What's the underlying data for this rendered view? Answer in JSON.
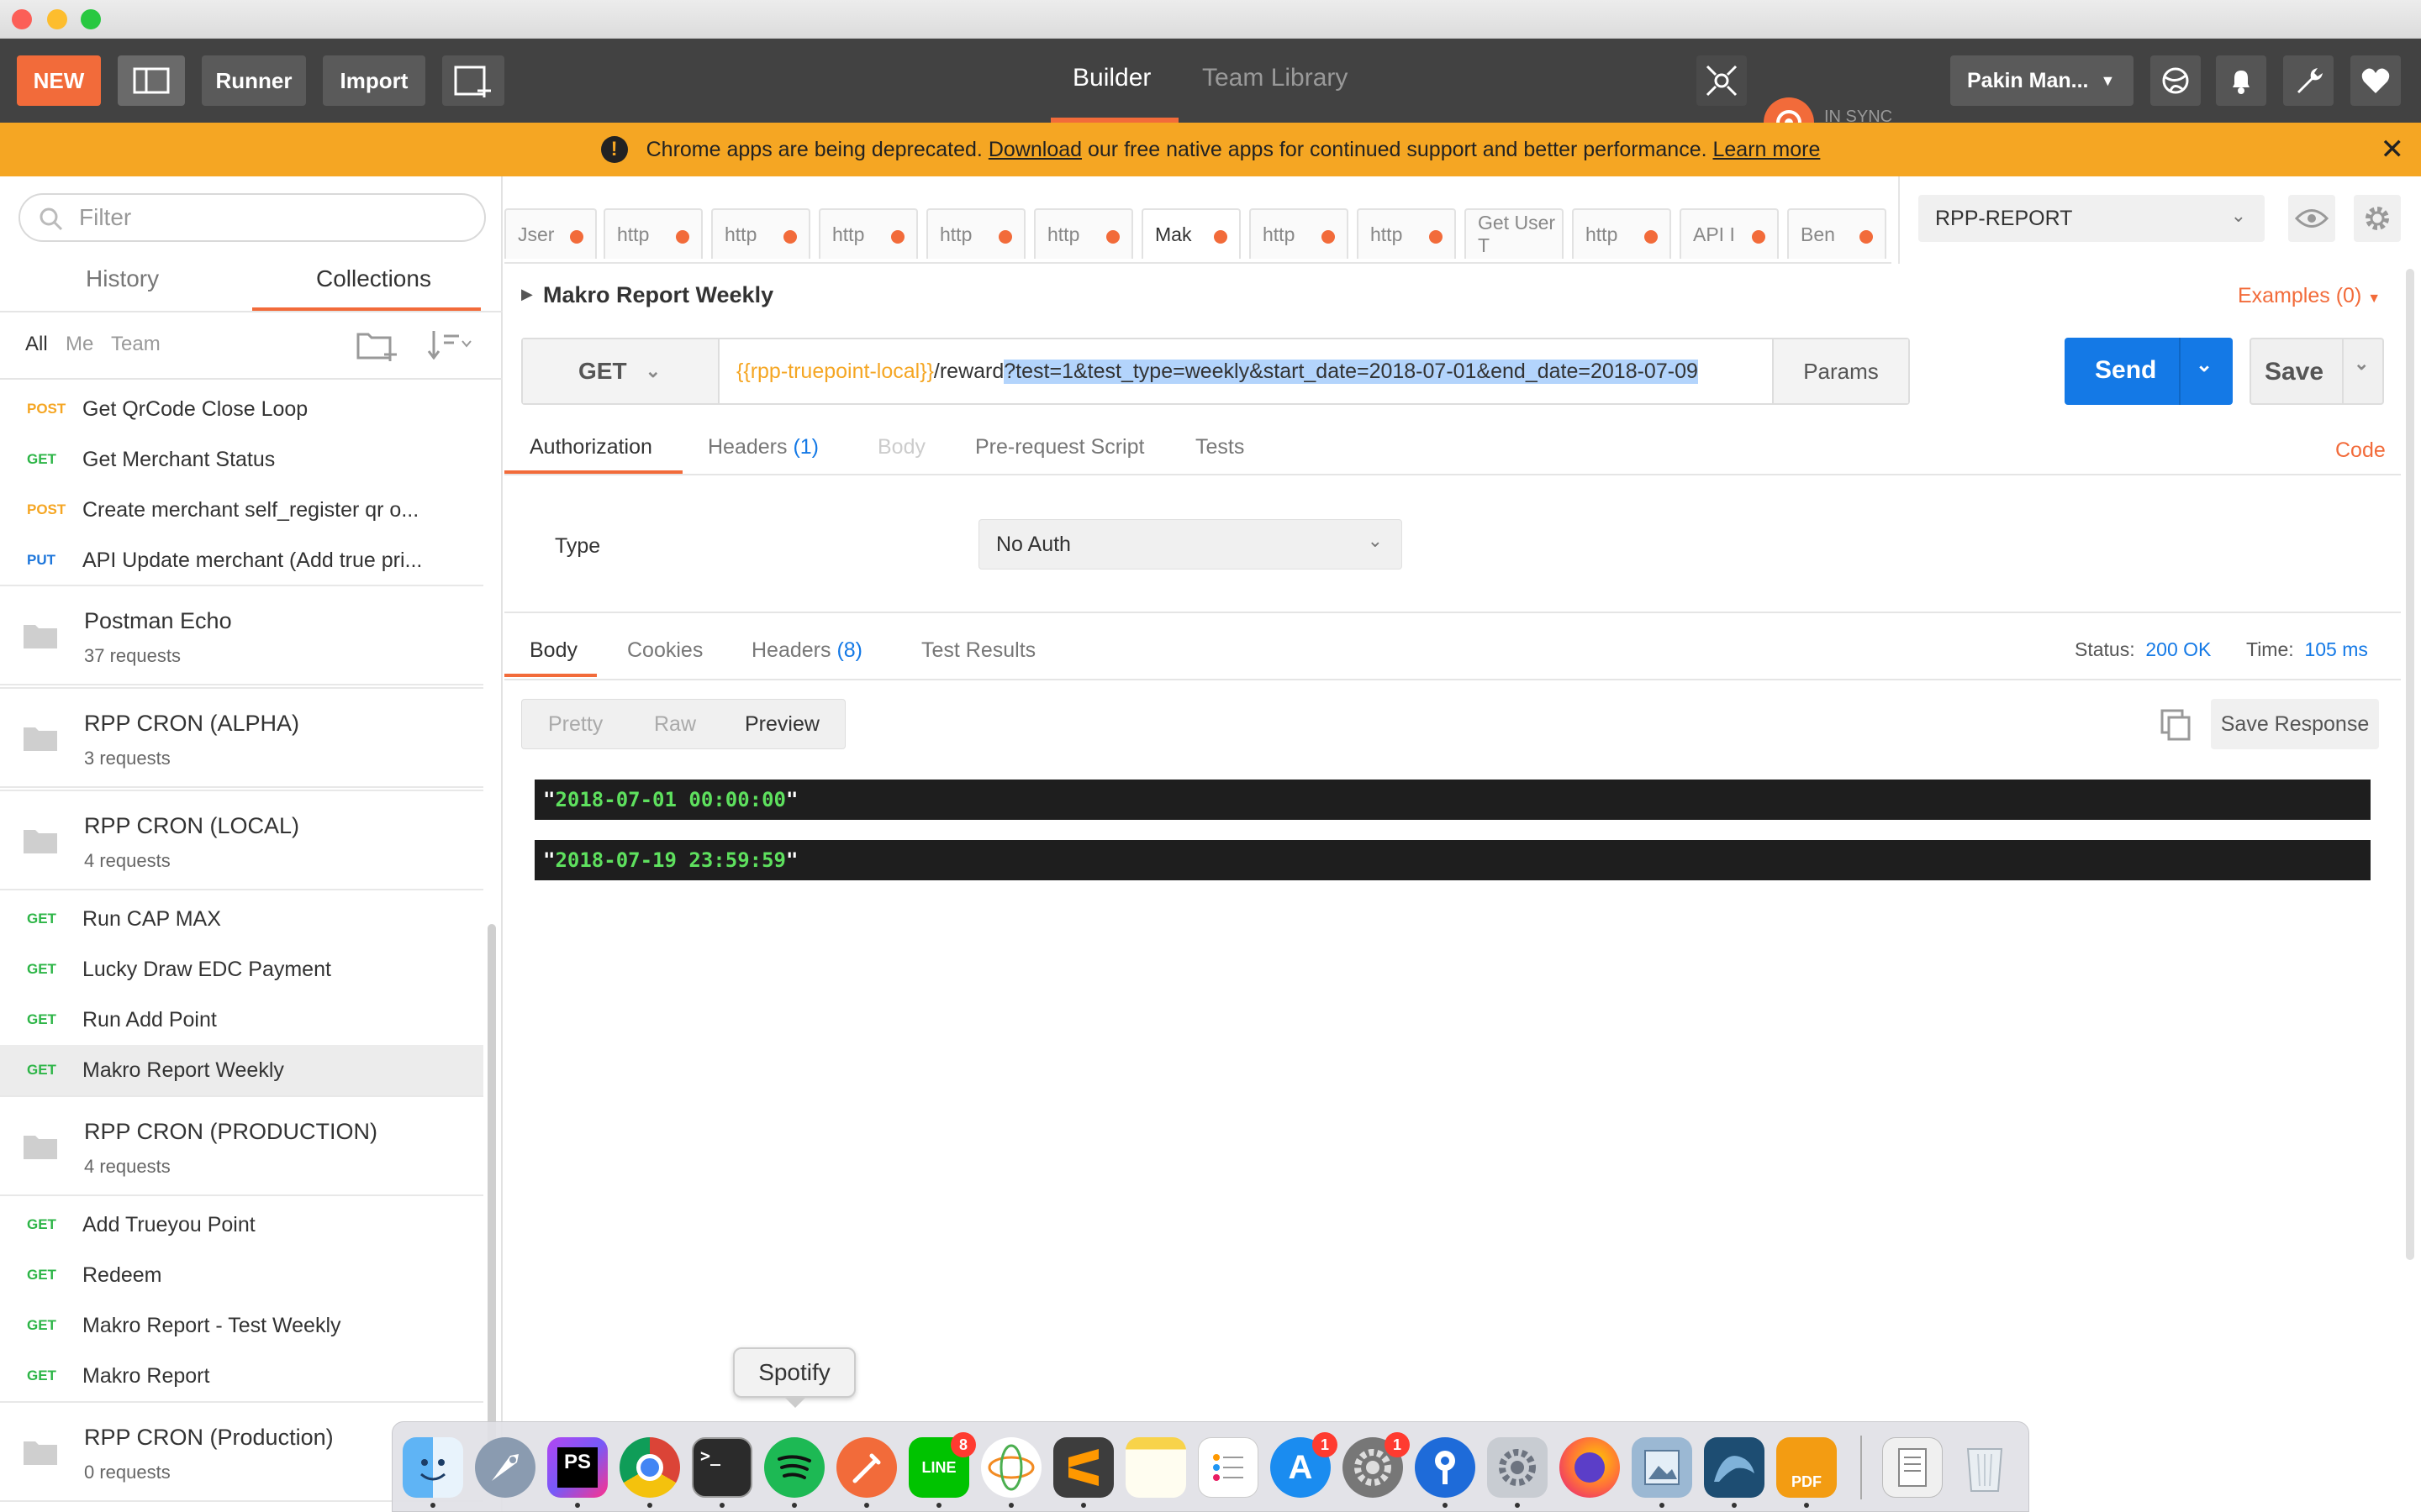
{
  "header": {
    "new_label": "NEW",
    "runner_label": "Runner",
    "import_label": "Import",
    "builder_tab": "Builder",
    "team_library_tab": "Team Library",
    "sync_status": "IN SYNC",
    "user_name": "Pakin Man...",
    "accent_color": "#f26b3a"
  },
  "banner": {
    "text": "Chrome apps are being deprecated.",
    "download_link": "Download",
    "text2": "our free native apps for continued support and better performance.",
    "learn_more_link": "Learn more"
  },
  "sidebar": {
    "filter_placeholder": "Filter",
    "tab_history": "History",
    "tab_collections": "Collections",
    "filter_all": "All",
    "filter_me": "Me",
    "filter_team": "Team",
    "requests_a": [
      {
        "method": "POST",
        "name": "Get QrCode Close Loop"
      },
      {
        "method": "GET",
        "name": "Get Merchant Status"
      },
      {
        "method": "POST",
        "name": "Create merchant self_register qr o..."
      },
      {
        "method": "PUT",
        "name": "API Update merchant (Add true pri..."
      }
    ],
    "folders": [
      {
        "name": "Postman Echo",
        "count": "37 requests"
      },
      {
        "name": "RPP CRON (ALPHA)",
        "count": "3 requests"
      },
      {
        "name": "RPP CRON (LOCAL)",
        "count": "4 requests"
      },
      {
        "name": "RPP CRON (PRODUCTION)",
        "count": "4 requests"
      },
      {
        "name": "RPP CRON (Production)",
        "count": "0 requests"
      }
    ],
    "requests_b": [
      {
        "method": "GET",
        "name": "Run CAP MAX"
      },
      {
        "method": "GET",
        "name": "Lucky Draw EDC Payment"
      },
      {
        "method": "GET",
        "name": "Run Add Point"
      },
      {
        "method": "GET",
        "name": "Makro Report Weekly"
      }
    ],
    "requests_c": [
      {
        "method": "GET",
        "name": "Add Trueyou Point"
      },
      {
        "method": "GET",
        "name": "Redeem"
      },
      {
        "method": "GET",
        "name": "Makro Report - Test Weekly"
      },
      {
        "method": "GET",
        "name": "Makro Report"
      }
    ]
  },
  "request_tabs": [
    "Jser",
    "http",
    "http",
    "http",
    "http",
    "http",
    "Mak",
    "http",
    "http",
    "Get User T",
    "http",
    "API I",
    "Ben"
  ],
  "environment": "RPP-REPORT",
  "request": {
    "title": "Makro Report Weekly",
    "examples": "Examples (0)",
    "method": "GET",
    "url_var": "{{rpp-truepoint-local}}",
    "url_path": "/reward",
    "url_query": "?test=1&test_type=weekly&start_date=2018-07-01&end_date=2018-07-09",
    "params_label": "Params",
    "send_label": "Send",
    "save_label": "Save"
  },
  "req_tabs": {
    "authorization": "Authorization",
    "headers": "Headers",
    "headers_count": "(1)",
    "body": "Body",
    "prerequest": "Pre-request Script",
    "tests": "Tests",
    "code": "Code"
  },
  "auth": {
    "type_label": "Type",
    "type_value": "No Auth"
  },
  "response": {
    "tab_body": "Body",
    "tab_cookies": "Cookies",
    "tab_headers": "Headers",
    "tab_headers_count": "(8)",
    "tab_tests": "Test Results",
    "status_label": "Status:",
    "status_value": "200 OK",
    "time_label": "Time:",
    "time_value": "105 ms",
    "view_pretty": "Pretty",
    "view_raw": "Raw",
    "view_preview": "Preview",
    "save_response": "Save Response",
    "lines": [
      "2018-07-01 00:00:00",
      "2018-07-19 23:59:59"
    ]
  },
  "dock": {
    "tooltip": "Spotify",
    "line_badge": "8",
    "appstore_badge": "1",
    "prefs_badge": "1"
  }
}
